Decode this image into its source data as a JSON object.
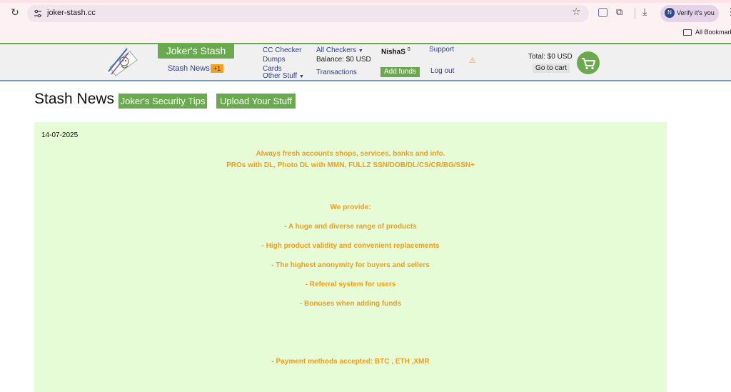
{
  "browser": {
    "url": "joker-stash.cc",
    "profile_label": "Verify it's you",
    "profile_initial": "N",
    "bookmarks_label": "All Bookmarks"
  },
  "header": {
    "brand": "Joker's Stash",
    "stash_news": "Stash News",
    "news_badge": "+1",
    "nav": {
      "cc_checker": "CC Checker",
      "dumps": "Dumps",
      "cards": "Cards",
      "other_stuff": "Other Stuff",
      "all_checkers": "All Checkers",
      "balance": "Balance: $0 USD",
      "transactions": "Transactions",
      "username": "NishaS",
      "user_count": "0",
      "add_funds": "Add funds",
      "support": "Support",
      "log_out": "Log out"
    },
    "cart": {
      "total": "Total: $0 USD",
      "go_to_cart": "Go to cart"
    }
  },
  "page": {
    "title": "Stash News",
    "security_tips": "Joker's Security Tips",
    "upload": "Upload Your Stuff"
  },
  "news": {
    "date": "14-07-2025",
    "lines": [
      "Always fresh accounts shops, services, banks and info.",
      "PROs with DL, Photo DL with MMN, FULLZ SSN/DOB/DL/CS/CR/BG/SSN+",
      "We provide:",
      "- A huge and diverse range of products",
      "- High product validity and convenient replacements",
      "- The highest anonymity for buyers and sellers",
      "- Referral system for users",
      "- Bonuses when adding funds",
      "- Payment methods accepted: BTC , ETH ,XMR"
    ]
  },
  "colors": {
    "brand_green": "#6aaa4e",
    "news_bg": "#e6fcd6",
    "news_text": "#f39c1a",
    "badge_orange": "#f5a021",
    "link_blue": "#2a3f8c"
  },
  "icons": [
    "reload-icon",
    "site-info-icon",
    "star-icon",
    "extension-icon",
    "puzzle-icon",
    "download-icon",
    "kebab-menu-icon",
    "folder-icon",
    "warning-icon",
    "cart-icon",
    "joker-logo"
  ]
}
